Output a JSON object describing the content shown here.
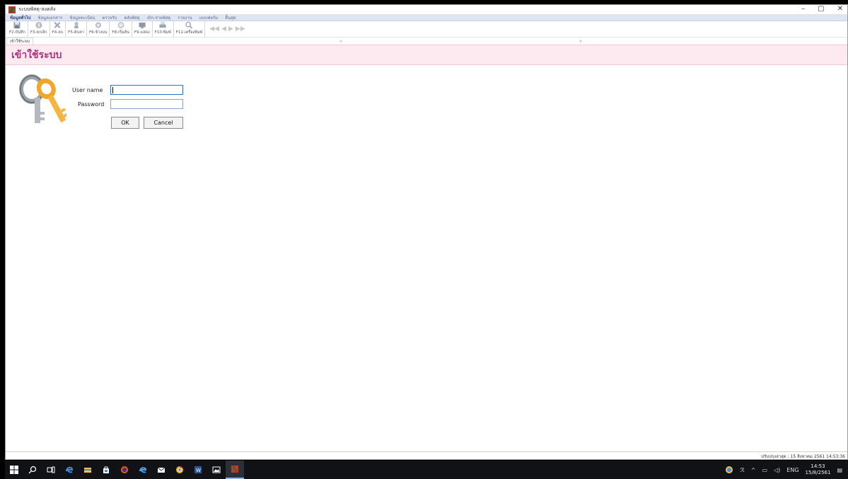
{
  "window": {
    "title": "ระบบพัสดุ-ลงคลัง",
    "controls": [
      "–",
      "▢",
      "✕"
    ]
  },
  "menu": {
    "items": [
      {
        "label": "ข้อมูลทั่วไป",
        "active": true
      },
      {
        "label": "ข้อมูลเอกสาร",
        "active": false
      },
      {
        "label": "ข้อมูลทะเบียน",
        "active": false
      },
      {
        "label": "ตรวจรับ",
        "active": false
      },
      {
        "label": "คลังพัสดุ",
        "active": false
      },
      {
        "label": "เบิก-จ่ายพัสดุ",
        "active": false
      },
      {
        "label": "รายงาน",
        "active": false
      },
      {
        "label": "แบบฟอร์ม",
        "active": false
      },
      {
        "label": "สิ้นสุด",
        "active": false
      }
    ]
  },
  "toolbar": {
    "buttons": [
      {
        "label": "F2-บันทึก",
        "icon": "save-icon"
      },
      {
        "label": "F3-ยกเลิก",
        "icon": "cancel-icon"
      },
      {
        "label": "F4-ลบ",
        "icon": "delete-icon"
      },
      {
        "label": "F5-ค้นหา",
        "icon": "search-icon"
      },
      {
        "label": "F6-ข้างบน",
        "icon": "gear-icon"
      },
      {
        "label": "F8-เริ่มต้น",
        "icon": "reset-icon"
      },
      {
        "label": "F9-แสดง",
        "icon": "display-icon"
      },
      {
        "label": "F10-พิมพ์",
        "icon": "print-icon"
      },
      {
        "label": "F11-เครื่องพิมพ์",
        "icon": "printer-setup-icon"
      }
    ],
    "nav_arrows": [
      "first-icon",
      "prev-icon",
      "next-icon",
      "last-icon"
    ]
  },
  "tabs": {
    "active_label": "เข้าใช้ระบบ"
  },
  "page": {
    "title": "เข้าใช้ระบบ"
  },
  "login": {
    "username_label": "User name",
    "password_label": "Password",
    "username_value": "",
    "password_value": "",
    "ok_label": "OK",
    "cancel_label": "Cancel"
  },
  "status": {
    "text": "ปรับปรุงล่าสุด : 15 สิงหาคม 2561  14:53:36"
  },
  "taskbar": {
    "apps": [
      "windows-start-icon",
      "search-icon",
      "task-view-icon",
      "edge-icon",
      "file-explorer-icon",
      "store-icon",
      "firefox-icon",
      "ie-icon",
      "mail-icon",
      "chrome-icon",
      "word-icon",
      "photos-icon",
      "app-icon"
    ],
    "tray_lang": "ENG",
    "time": "14:53",
    "date": "15/8/2561"
  },
  "colors": {
    "page_title": "#b0307a",
    "header_bg": "#fdeaf1",
    "menubar_bg": "#dfe6f1"
  }
}
